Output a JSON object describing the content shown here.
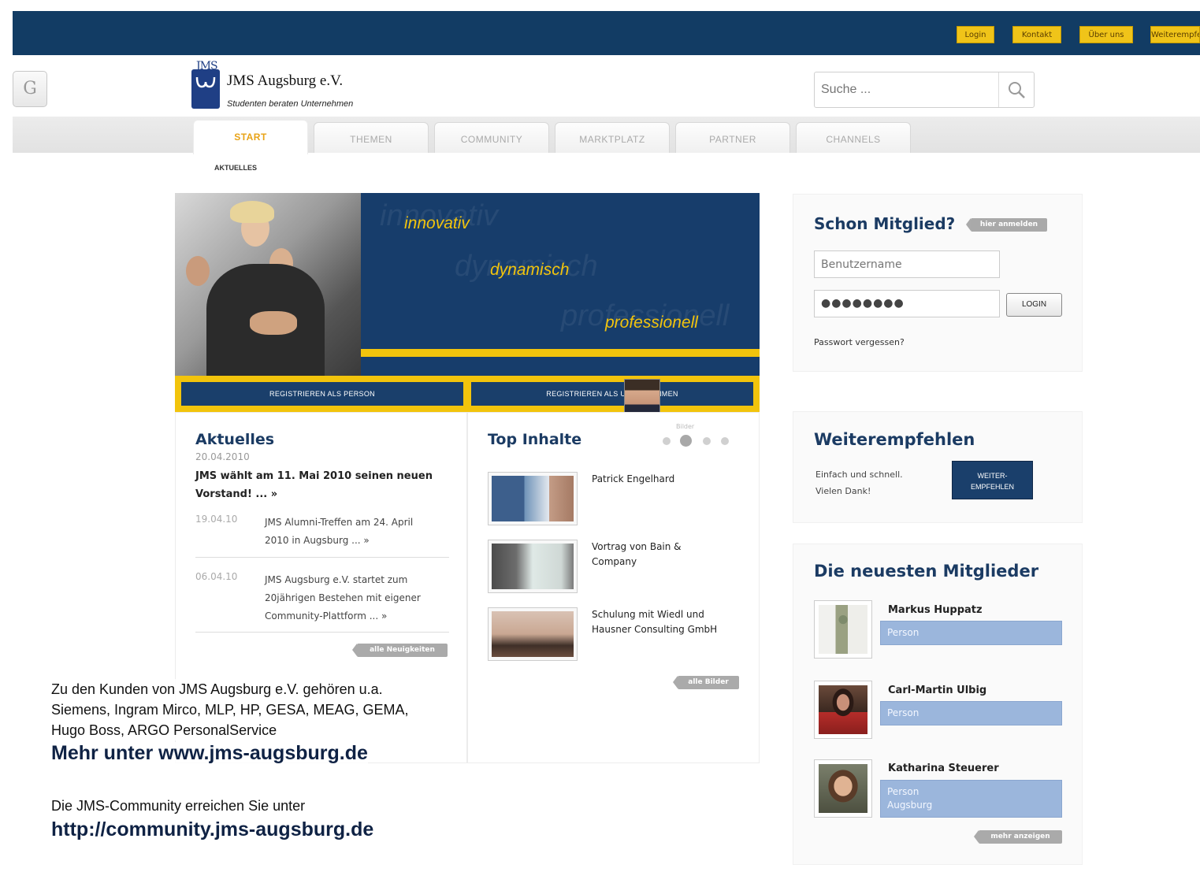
{
  "top_nav": [
    "Login",
    "Kontakt",
    "Über uns",
    "Weiterempfehlen"
  ],
  "header": {
    "g_button": "G",
    "logo_text": "JMS",
    "site_title": "JMS Augsburg e.V.",
    "site_subtitle": "Studenten beraten Unternehmen",
    "search_placeholder": "Suche ..."
  },
  "tabs": [
    "START",
    "THEMEN",
    "COMMUNITY",
    "MARKTPLATZ",
    "PARTNER",
    "CHANNELS"
  ],
  "active_tab": "START",
  "subnav": "AKTUELLES",
  "hero": {
    "word1": "innovativ",
    "word2": "dynamisch",
    "word3": "professionell"
  },
  "register": {
    "person": "REGISTRIEREN ALS PERSON",
    "company": "REGISTRIEREN ALS UNTERNEHMEN"
  },
  "news": {
    "title": "Aktuelles",
    "lead_date": "20.04.2010",
    "lead_line1": "JMS wählt am 11. Mai 2010 seinen neuen",
    "lead_line2": "Vorstand! ... »",
    "items": [
      {
        "date": "19.04.10",
        "line1": "JMS Alumni-Treffen am 24. April",
        "line2": "2010 in Augsburg ... »",
        "line3": ""
      },
      {
        "date": "06.04.10",
        "line1": "JMS Augsburg e.V. startet zum",
        "line2": "20jährigen Bestehen mit eigener",
        "line3": "Community-Plattform ... »"
      }
    ],
    "all_link": "alle Neuigkeiten"
  },
  "top_content": {
    "title": "Top Inhalte",
    "pager_label": "Bilder",
    "items": [
      {
        "line1": "Patrick Engelhard",
        "line2": ""
      },
      {
        "line1": "Vortrag von Bain &",
        "line2": "Company"
      },
      {
        "line1": "Schulung mit Wiedl und",
        "line2": "Hausner Consulting GmbH"
      }
    ],
    "all_link": "alle Bilder"
  },
  "login_box": {
    "title": "Schon Mitglied?",
    "badge": "hier anmelden",
    "username_placeholder": "Benutzername",
    "password_value": "●●●●●●●●",
    "login_button": "LOGIN",
    "forgot": "Passwort vergessen?"
  },
  "recommend_box": {
    "title": "Weiterempfehlen",
    "text_line1": "Einfach und schnell.",
    "text_line2": "Vielen Dank!",
    "button_line1": "WEITER-",
    "button_line2": "EMPFEHLEN"
  },
  "members_box": {
    "title": "Die neuesten Mitglieder",
    "members": [
      {
        "name": "Markus Huppatz",
        "tag_line1": "Person",
        "tag_line2": ""
      },
      {
        "name": "Carl-Martin Ulbig",
        "tag_line1": "Person",
        "tag_line2": ""
      },
      {
        "name": "Katharina Steuerer",
        "tag_line1": "Person",
        "tag_line2": "Augsburg"
      }
    ],
    "more_link": "mehr anzeigen"
  },
  "caption": {
    "line1": "Zu den Kunden von JMS Augsburg e.V. gehören u.a.",
    "line2": "Siemens, Ingram Mirco, MLP, HP, GESA, MEAG, GEMA,",
    "line3": "Hugo Boss, ARGO PersonalService",
    "more": "Mehr unter www.jms-augsburg.de",
    "community_label": "Die JMS-Community erreichen Sie unter",
    "community_url": "http://community.jms-augsburg.de"
  },
  "colors": {
    "navy": "#123c64",
    "yellow": "#f2c40c",
    "accent_orange": "#e8a317",
    "member_tag": "#9bb6dc"
  }
}
